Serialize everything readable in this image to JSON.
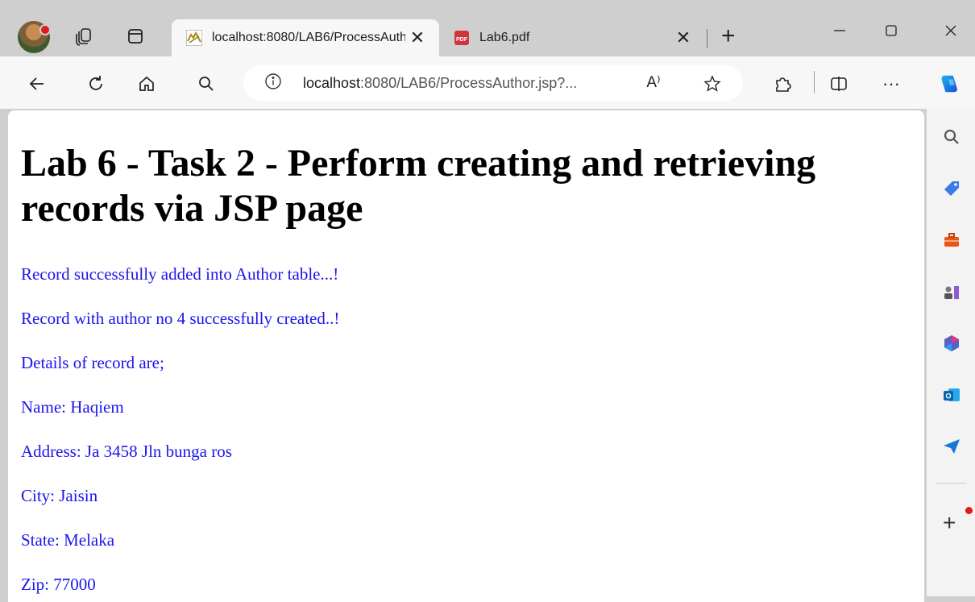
{
  "browser": {
    "tabs": [
      {
        "title": "localhost:8080/LAB6/ProcessAuthor.jsp?",
        "active": true,
        "favicon": "tomcat-icon"
      },
      {
        "title": "Lab6.pdf",
        "active": false,
        "favicon": "pdf-icon"
      }
    ],
    "address": {
      "host": "localhost",
      "rest": ":8080/LAB6/ProcessAuthor.jsp?..."
    },
    "read_aloud_icon": "A⁾"
  },
  "page": {
    "heading": "Lab 6 - Task 2 - Perform creating and retrieving records via JSP page",
    "lines": [
      "Record successfully added into Author table...!",
      "Record with author no 4 successfully created..!",
      "Details of record are;",
      "Name: Haqiem",
      "Address: Ja 3458 Jln bunga ros",
      "City: Jaisin",
      "State: Melaka",
      "Zip: 77000"
    ]
  },
  "colors": {
    "message_text": "#1a14ee"
  }
}
